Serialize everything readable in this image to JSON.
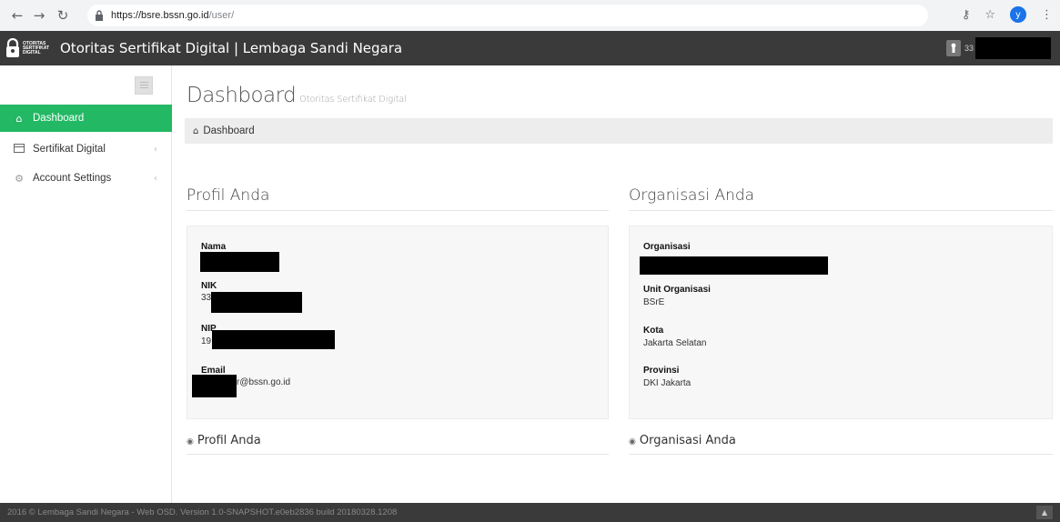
{
  "browser": {
    "url_host": "https://bsre.bssn.go.id",
    "url_path": "/user/",
    "back_icon": "arrow-left-icon",
    "forward_icon": "arrow-right-icon",
    "reload_icon": "reload-icon",
    "profile_initial": "y"
  },
  "header": {
    "logo_text": "OTORITAS SERTIFIKAT DIGITAL",
    "title": "Otoritas Sertifikat Digital | Lembaga Sandi Negara",
    "user_id_prefix": "33"
  },
  "sidebar": {
    "items": [
      {
        "label": "Dashboard",
        "icon": "home-icon",
        "active": true
      },
      {
        "label": "Sertifikat Digital",
        "icon": "card-icon",
        "active": false
      },
      {
        "label": "Account Settings",
        "icon": "cogs-icon",
        "active": false
      }
    ]
  },
  "main": {
    "title": "Dashboard",
    "subtitle": "Otoritas Sertifikat Digital",
    "breadcrumb": "Dashboard",
    "profile": {
      "heading": "Profil Anda",
      "fields": [
        {
          "label": "Nama",
          "value": ""
        },
        {
          "label": "NIK",
          "value": "33"
        },
        {
          "label": "NIP",
          "value": "19"
        },
        {
          "label": "Email",
          "value": "r@bssn.go.id"
        }
      ],
      "footer": "Profil Anda"
    },
    "organization": {
      "heading": "Organisasi Anda",
      "fields": [
        {
          "label": "Organisasi",
          "value": ""
        },
        {
          "label": "Unit Organisasi",
          "value": "BSrE"
        },
        {
          "label": "Kota",
          "value": "Jakarta Selatan"
        },
        {
          "label": "Provinsi",
          "value": "DKI Jakarta"
        }
      ],
      "footer": "Organisasi Anda"
    }
  },
  "footer": {
    "text": "2016 © Lembaga Sandi Negara - Web OSD. Version 1.0-SNAPSHOT.e0eb2836 build 20180328.1208"
  },
  "colors": {
    "active_nav": "#23b864",
    "header_bg": "#3a3a3a",
    "panel_bg": "#f7f7f7"
  }
}
